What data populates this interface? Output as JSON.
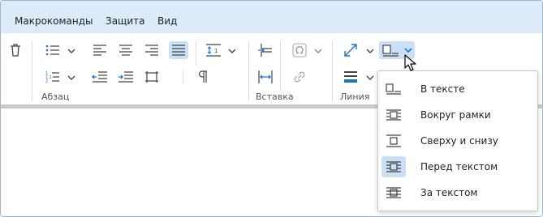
{
  "menubar": {
    "items": [
      {
        "label": "Макрокоманды"
      },
      {
        "label": "Защита"
      },
      {
        "label": "Вид"
      }
    ]
  },
  "ribbon": {
    "groups": {
      "paragraph": {
        "label": "Абзац"
      },
      "insert": {
        "label": "Вставка"
      },
      "line": {
        "label": "Линия"
      }
    }
  },
  "wrap_menu": {
    "items": [
      {
        "label": "В тексте",
        "icon": "wrap-inline-icon",
        "selected": false
      },
      {
        "label": "Вокруг рамки",
        "icon": "wrap-square-icon",
        "selected": false
      },
      {
        "label": "Сверху и снизу",
        "icon": "wrap-top-bottom-icon",
        "selected": false
      },
      {
        "label": "Перед текстом",
        "icon": "wrap-in-front-icon",
        "selected": true
      },
      {
        "label": "За текстом",
        "icon": "wrap-behind-icon",
        "selected": false
      }
    ]
  },
  "colors": {
    "accent": "#1a73c8",
    "menubar_bg": "#dcebfa",
    "active_bg": "#c9e0f6"
  }
}
